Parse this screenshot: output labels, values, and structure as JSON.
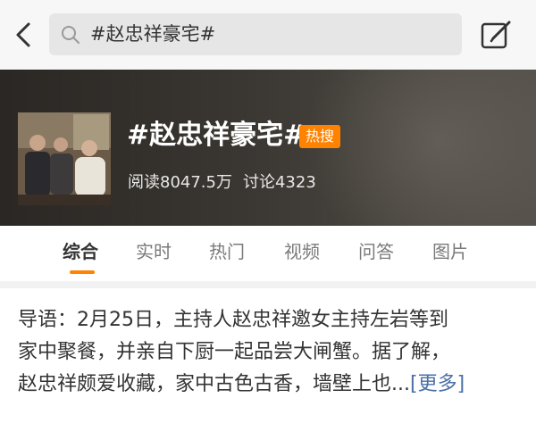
{
  "header": {
    "search_text": "#赵忠祥豪宅#"
  },
  "banner": {
    "title": "#赵忠祥豪宅#",
    "badge": "热搜",
    "reads": "阅读8047.5万",
    "discussions": "讨论4323"
  },
  "tabs": [
    {
      "label": "综合",
      "active": true
    },
    {
      "label": "实时",
      "active": false
    },
    {
      "label": "热门",
      "active": false
    },
    {
      "label": "视频",
      "active": false
    },
    {
      "label": "问答",
      "active": false
    },
    {
      "label": "图片",
      "active": false
    }
  ],
  "intro": {
    "line1": "导语：2月25日，主持人赵忠祥邀女主持左岩等到",
    "line2": "家中聚餐，并亲自下厨一起品尝大闸蟹。据了解，",
    "line3": "赵忠祥颇爱收藏，家中古色古香，墙壁上也...",
    "more": "[更多]"
  },
  "colors": {
    "accent": "#ff8200",
    "link": "#4a6fa5"
  },
  "icons": [
    "back-arrow-icon",
    "search-icon",
    "compose-icon"
  ]
}
